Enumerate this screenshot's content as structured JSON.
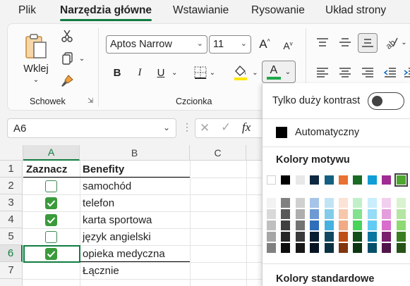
{
  "tabs": [
    "Plik",
    "Narzędzia główne",
    "Wstawianie",
    "Rysowanie",
    "Układ strony"
  ],
  "active_tab": "Narzędzia główne",
  "ribbon": {
    "paste_label": "Wklej",
    "clipboard_group": "Schowek",
    "font_group": "Czcionka",
    "font_name": "Aptos Narrow",
    "font_size": "11",
    "bold": "B",
    "italic": "I",
    "underline": "U",
    "font_color_letter": "A",
    "font_color_accent": "#1ea84a",
    "highlight_accent": "#ffd700"
  },
  "formula_bar": {
    "name_box": "A6",
    "fx": "fx"
  },
  "sheet": {
    "columns": [
      "A",
      "B",
      "C"
    ],
    "rows": [
      "1",
      "2",
      "3",
      "4",
      "5",
      "6",
      "7"
    ],
    "selected_cell": "A6",
    "header_a": "Zaznacz",
    "header_b": "Benefity",
    "items": [
      {
        "label": "samochód",
        "checked": false
      },
      {
        "label": "telefon",
        "checked": true
      },
      {
        "label": "karta sportowa",
        "checked": true
      },
      {
        "label": "język angielski",
        "checked": false
      },
      {
        "label": "opieka medyczna",
        "checked": true
      }
    ],
    "total_label": "Łącznie"
  },
  "color_dropdown": {
    "high_contrast_label": "Tylko duży kontrast",
    "automatic_label": "Automatyczny",
    "theme_colors_title": "Kolory motywu",
    "standard_colors_title": "Kolory standardowe",
    "theme_colors": [
      "#ffffff",
      "#000000",
      "#e8e8e8",
      "#0e2841",
      "#156082",
      "#e97132",
      "#196b24",
      "#0f9ed5",
      "#a02b93",
      "#4ea72e"
    ],
    "theme_shades": [
      [
        "#f2f2f2",
        "#808080",
        "#d0d0d0",
        "#a6c4e8",
        "#c1e4f5",
        "#fbe3d6",
        "#c1f0c8",
        "#caeefb",
        "#f2cfee",
        "#d9f2d0"
      ],
      [
        "#d9d9d9",
        "#595959",
        "#aeaeae",
        "#6d99d4",
        "#83cbeb",
        "#f7c7ac",
        "#83e28e",
        "#95dcf7",
        "#e59edd",
        "#b4e5a2"
      ],
      [
        "#bfbfbf",
        "#404040",
        "#747474",
        "#2f6eba",
        "#46b1e1",
        "#f2aa84",
        "#47d459",
        "#61cbf4",
        "#d86dcb",
        "#8ed973"
      ],
      [
        "#a6a6a6",
        "#262626",
        "#3a3a3a",
        "#0a1e33",
        "#104862",
        "#c04f15",
        "#124f1a",
        "#0b76a0",
        "#78206e",
        "#3b7d23"
      ],
      [
        "#808080",
        "#0d0d0d",
        "#171717",
        "#061421",
        "#0a3041",
        "#80350e",
        "#0c3511",
        "#074f69",
        "#501549",
        "#275317"
      ]
    ]
  }
}
